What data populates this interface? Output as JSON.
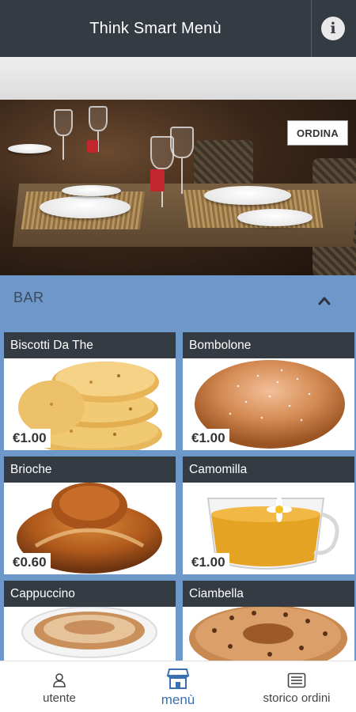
{
  "header": {
    "title": "Think Smart Menù",
    "info_icon": "info-icon"
  },
  "hero": {
    "order_button": "ORDINA"
  },
  "category": {
    "title": "BAR",
    "toggle_icon": "chevron-up-icon"
  },
  "products": [
    {
      "name": "Biscotti Da The",
      "price": "€1.00"
    },
    {
      "name": "Bombolone",
      "price": "€1.00"
    },
    {
      "name": "Brioche",
      "price": "€0.60"
    },
    {
      "name": "Camomilla",
      "price": "€1.00"
    },
    {
      "name": "Cappuccino",
      "price": ""
    },
    {
      "name": "Ciambella",
      "price": ""
    }
  ],
  "bottom_nav": {
    "items": [
      {
        "label": "utente",
        "icon": "user-icon"
      },
      {
        "label": "menù",
        "icon": "store-icon",
        "active": true
      },
      {
        "label": "storico ordini",
        "icon": "list-icon"
      }
    ]
  },
  "colors": {
    "header": "#353b43",
    "section": "#6d98c9",
    "active": "#3a6fb0"
  }
}
